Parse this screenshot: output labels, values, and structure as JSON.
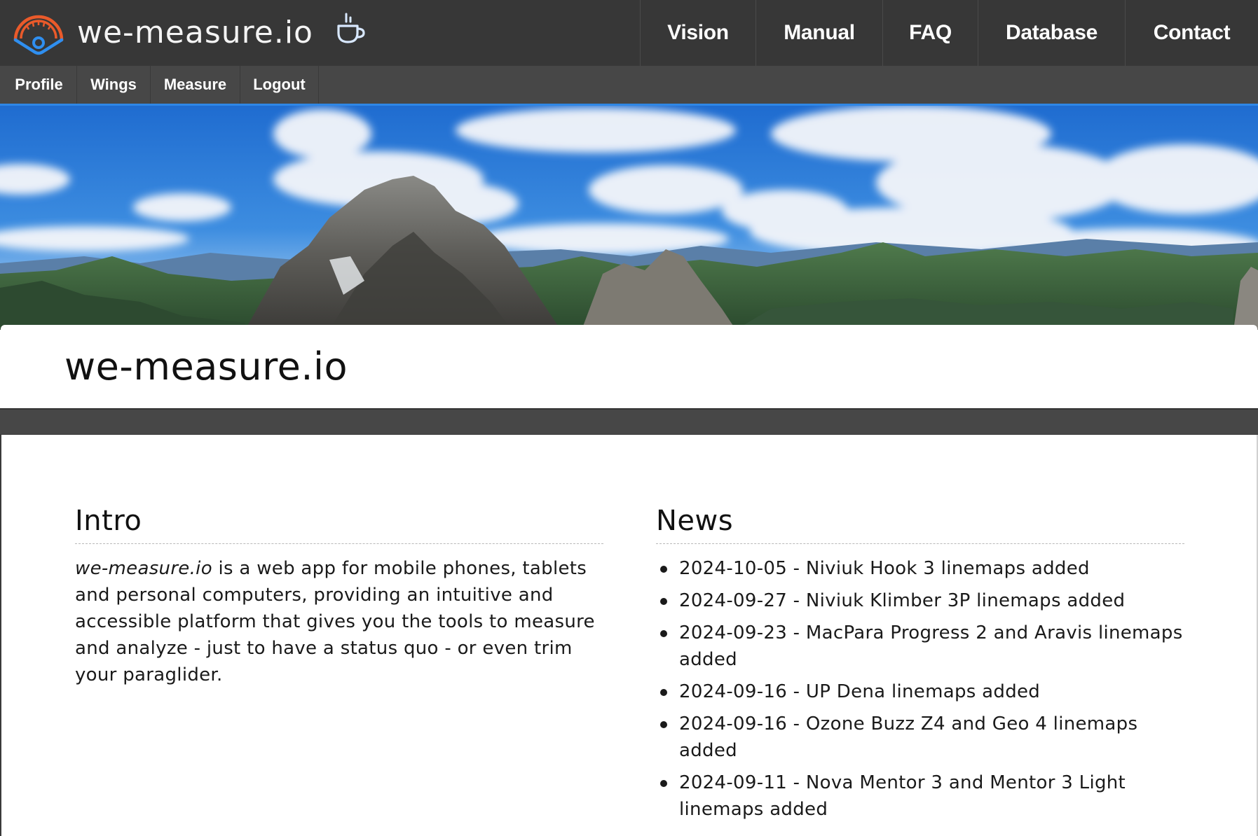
{
  "header": {
    "brand_name": "we-measure.io",
    "logo_icon": "gauge-eye-logo",
    "donate_icon": "coffee-cup-icon",
    "colors": {
      "topbar": "#373737",
      "subnav": "#474747",
      "accent": "#2f87e6",
      "logo_orange": "#ea5a2a",
      "logo_blue": "#2f8ff0"
    }
  },
  "main_nav": {
    "items": [
      {
        "label": "Vision"
      },
      {
        "label": "Manual"
      },
      {
        "label": "FAQ"
      },
      {
        "label": "Database"
      },
      {
        "label": "Contact"
      }
    ]
  },
  "sub_nav": {
    "items": [
      {
        "label": "Profile"
      },
      {
        "label": "Wings"
      },
      {
        "label": "Measure"
      },
      {
        "label": "Logout"
      }
    ]
  },
  "hero": {
    "description": "Panorama of alpine mountain peaks under blue sky with white clouds"
  },
  "page": {
    "title": "we-measure.io"
  },
  "intro": {
    "heading": "Intro",
    "brand_italic": "we-measure.io",
    "text": " is a web app for mobile phones, tablets and personal computers, providing an intuitive and accessible platform that gives you the tools to measure and analyze - just to have a status quo - or even trim your paraglider."
  },
  "news": {
    "heading": "News",
    "items": [
      {
        "text": "2024-10-05 - Niviuk Hook 3 linemaps added"
      },
      {
        "text": "2024-09-27 - Niviuk Klimber 3P linemaps added"
      },
      {
        "text": "2024-09-23 - MacPara Progress 2 and Aravis linemaps added"
      },
      {
        "text": "2024-09-16 - UP Dena linemaps added"
      },
      {
        "text": "2024-09-16 - Ozone Buzz Z4 and Geo 4 linemaps added"
      },
      {
        "text": "2024-09-11 - Nova Mentor 3 and Mentor 3 Light linemaps added"
      }
    ]
  }
}
